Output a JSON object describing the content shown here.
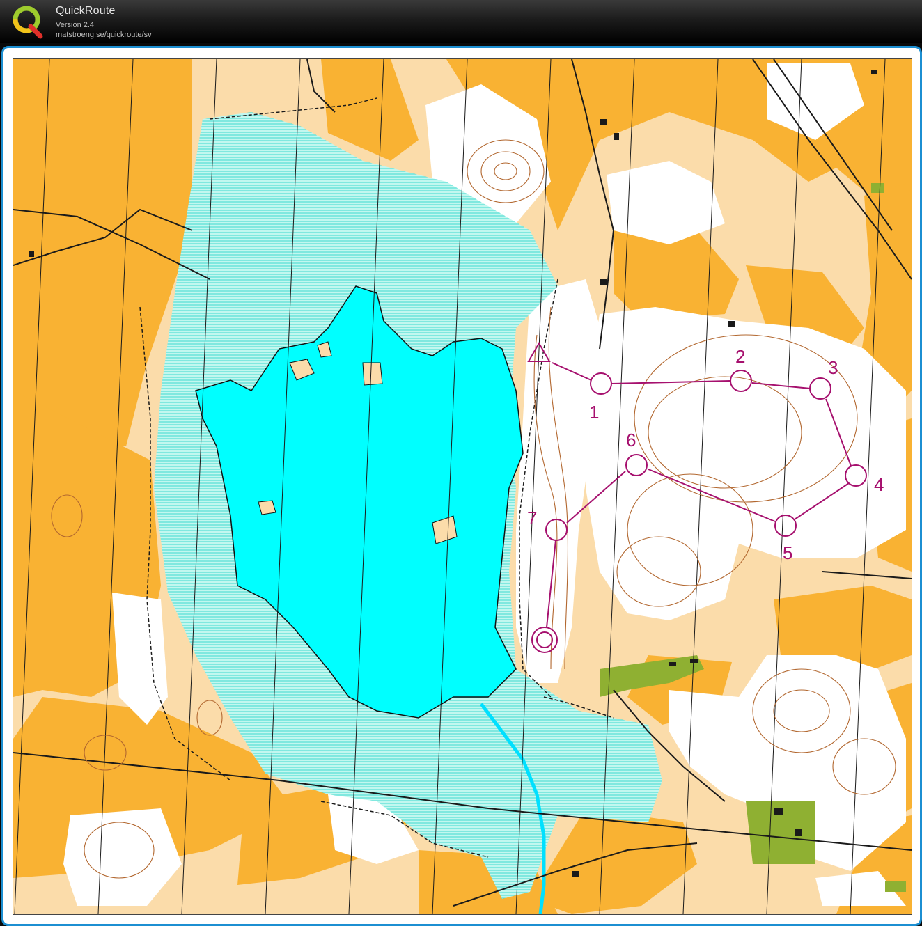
{
  "app": {
    "name": "QuickRoute",
    "version": "Version 2.4",
    "url": "matstroeng.se/quickroute/sv"
  },
  "map": {
    "kind": "orienteering-map",
    "colors": {
      "open_land": "#f9b233",
      "rough_open": "#fbdcaa",
      "forest": "#ffffff",
      "marsh": "#9ef1e6",
      "lake": "#00ffff",
      "green_vegetation": "#8fb032",
      "contour": "#b2672f",
      "course": "#a6106e",
      "track": "#1a1a1a"
    },
    "course": {
      "start_symbol": "triangle",
      "finish_symbol": "double-circle",
      "controls": [
        {
          "label": "1"
        },
        {
          "label": "2"
        },
        {
          "label": "3"
        },
        {
          "label": "4"
        },
        {
          "label": "5"
        },
        {
          "label": "6"
        },
        {
          "label": "7"
        }
      ]
    }
  }
}
